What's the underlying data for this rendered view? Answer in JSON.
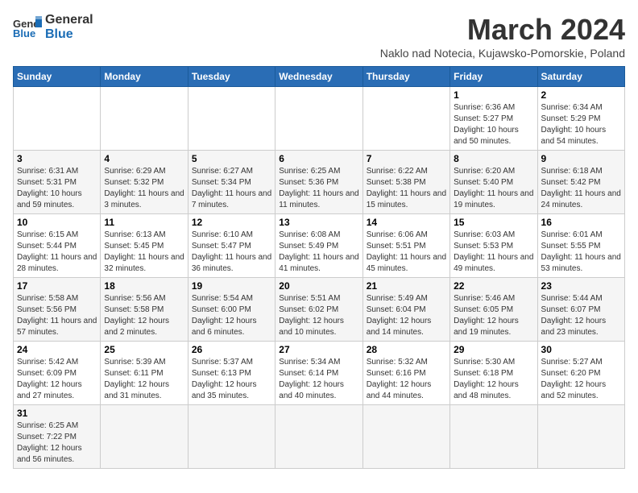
{
  "header": {
    "logo_general": "General",
    "logo_blue": "Blue",
    "month_title": "March 2024",
    "subtitle": "Naklo nad Notecia, Kujawsko-Pomorskie, Poland"
  },
  "weekdays": [
    "Sunday",
    "Monday",
    "Tuesday",
    "Wednesday",
    "Thursday",
    "Friday",
    "Saturday"
  ],
  "weeks": [
    [
      {
        "day": "",
        "info": ""
      },
      {
        "day": "",
        "info": ""
      },
      {
        "day": "",
        "info": ""
      },
      {
        "day": "",
        "info": ""
      },
      {
        "day": "",
        "info": ""
      },
      {
        "day": "1",
        "info": "Sunrise: 6:36 AM\nSunset: 5:27 PM\nDaylight: 10 hours and 50 minutes."
      },
      {
        "day": "2",
        "info": "Sunrise: 6:34 AM\nSunset: 5:29 PM\nDaylight: 10 hours and 54 minutes."
      }
    ],
    [
      {
        "day": "3",
        "info": "Sunrise: 6:31 AM\nSunset: 5:31 PM\nDaylight: 10 hours and 59 minutes."
      },
      {
        "day": "4",
        "info": "Sunrise: 6:29 AM\nSunset: 5:32 PM\nDaylight: 11 hours and 3 minutes."
      },
      {
        "day": "5",
        "info": "Sunrise: 6:27 AM\nSunset: 5:34 PM\nDaylight: 11 hours and 7 minutes."
      },
      {
        "day": "6",
        "info": "Sunrise: 6:25 AM\nSunset: 5:36 PM\nDaylight: 11 hours and 11 minutes."
      },
      {
        "day": "7",
        "info": "Sunrise: 6:22 AM\nSunset: 5:38 PM\nDaylight: 11 hours and 15 minutes."
      },
      {
        "day": "8",
        "info": "Sunrise: 6:20 AM\nSunset: 5:40 PM\nDaylight: 11 hours and 19 minutes."
      },
      {
        "day": "9",
        "info": "Sunrise: 6:18 AM\nSunset: 5:42 PM\nDaylight: 11 hours and 24 minutes."
      }
    ],
    [
      {
        "day": "10",
        "info": "Sunrise: 6:15 AM\nSunset: 5:44 PM\nDaylight: 11 hours and 28 minutes."
      },
      {
        "day": "11",
        "info": "Sunrise: 6:13 AM\nSunset: 5:45 PM\nDaylight: 11 hours and 32 minutes."
      },
      {
        "day": "12",
        "info": "Sunrise: 6:10 AM\nSunset: 5:47 PM\nDaylight: 11 hours and 36 minutes."
      },
      {
        "day": "13",
        "info": "Sunrise: 6:08 AM\nSunset: 5:49 PM\nDaylight: 11 hours and 41 minutes."
      },
      {
        "day": "14",
        "info": "Sunrise: 6:06 AM\nSunset: 5:51 PM\nDaylight: 11 hours and 45 minutes."
      },
      {
        "day": "15",
        "info": "Sunrise: 6:03 AM\nSunset: 5:53 PM\nDaylight: 11 hours and 49 minutes."
      },
      {
        "day": "16",
        "info": "Sunrise: 6:01 AM\nSunset: 5:55 PM\nDaylight: 11 hours and 53 minutes."
      }
    ],
    [
      {
        "day": "17",
        "info": "Sunrise: 5:58 AM\nSunset: 5:56 PM\nDaylight: 11 hours and 57 minutes."
      },
      {
        "day": "18",
        "info": "Sunrise: 5:56 AM\nSunset: 5:58 PM\nDaylight: 12 hours and 2 minutes."
      },
      {
        "day": "19",
        "info": "Sunrise: 5:54 AM\nSunset: 6:00 PM\nDaylight: 12 hours and 6 minutes."
      },
      {
        "day": "20",
        "info": "Sunrise: 5:51 AM\nSunset: 6:02 PM\nDaylight: 12 hours and 10 minutes."
      },
      {
        "day": "21",
        "info": "Sunrise: 5:49 AM\nSunset: 6:04 PM\nDaylight: 12 hours and 14 minutes."
      },
      {
        "day": "22",
        "info": "Sunrise: 5:46 AM\nSunset: 6:05 PM\nDaylight: 12 hours and 19 minutes."
      },
      {
        "day": "23",
        "info": "Sunrise: 5:44 AM\nSunset: 6:07 PM\nDaylight: 12 hours and 23 minutes."
      }
    ],
    [
      {
        "day": "24",
        "info": "Sunrise: 5:42 AM\nSunset: 6:09 PM\nDaylight: 12 hours and 27 minutes."
      },
      {
        "day": "25",
        "info": "Sunrise: 5:39 AM\nSunset: 6:11 PM\nDaylight: 12 hours and 31 minutes."
      },
      {
        "day": "26",
        "info": "Sunrise: 5:37 AM\nSunset: 6:13 PM\nDaylight: 12 hours and 35 minutes."
      },
      {
        "day": "27",
        "info": "Sunrise: 5:34 AM\nSunset: 6:14 PM\nDaylight: 12 hours and 40 minutes."
      },
      {
        "day": "28",
        "info": "Sunrise: 5:32 AM\nSunset: 6:16 PM\nDaylight: 12 hours and 44 minutes."
      },
      {
        "day": "29",
        "info": "Sunrise: 5:30 AM\nSunset: 6:18 PM\nDaylight: 12 hours and 48 minutes."
      },
      {
        "day": "30",
        "info": "Sunrise: 5:27 AM\nSunset: 6:20 PM\nDaylight: 12 hours and 52 minutes."
      }
    ],
    [
      {
        "day": "31",
        "info": "Sunrise: 6:25 AM\nSunset: 7:22 PM\nDaylight: 12 hours and 56 minutes."
      },
      {
        "day": "",
        "info": ""
      },
      {
        "day": "",
        "info": ""
      },
      {
        "day": "",
        "info": ""
      },
      {
        "day": "",
        "info": ""
      },
      {
        "day": "",
        "info": ""
      },
      {
        "day": "",
        "info": ""
      }
    ]
  ]
}
